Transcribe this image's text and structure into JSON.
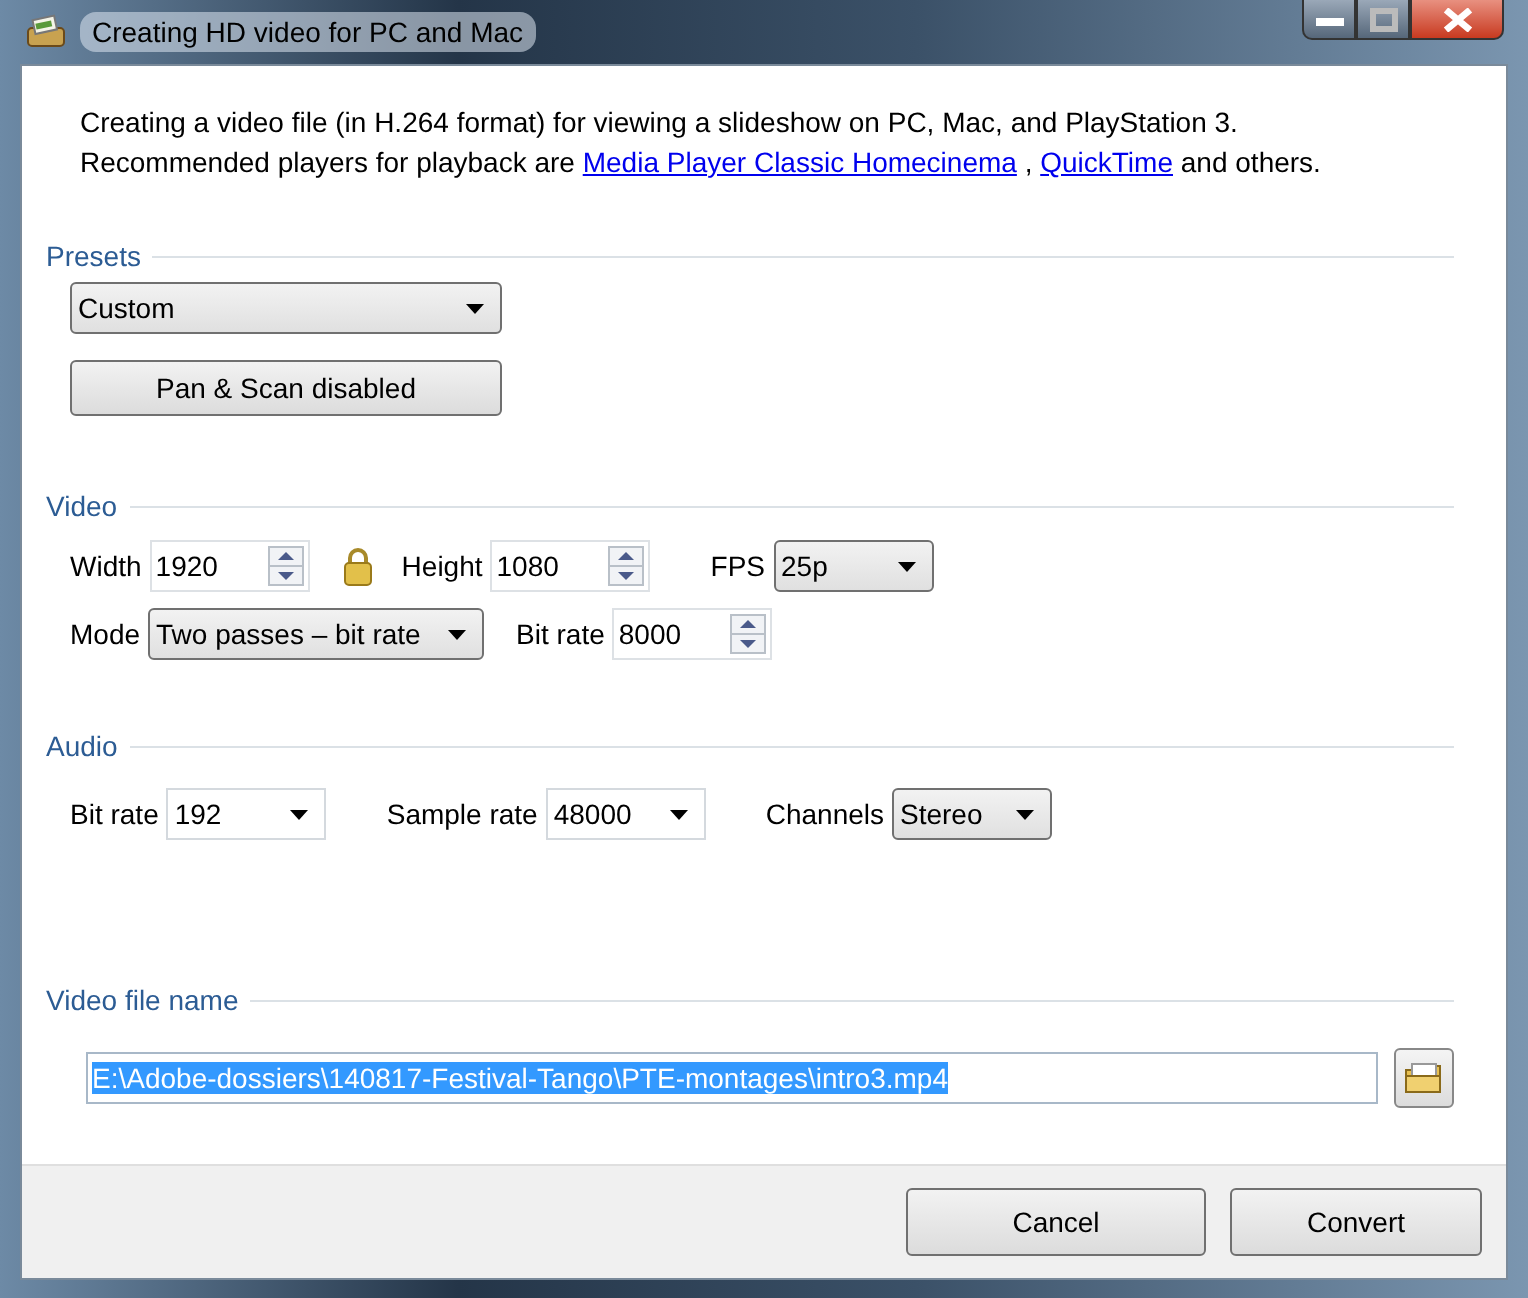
{
  "window": {
    "title": "Creating HD video for PC and Mac"
  },
  "intro": {
    "line1": "Creating a video file (in H.264 format) for viewing a slideshow on PC, Mac, and PlayStation 3.",
    "lead": "Recommended players for playback are",
    "links": [
      "Media Player Classic Homecinema",
      "QuickTime"
    ],
    "separator": ",",
    "tail": "and others."
  },
  "presets": {
    "title": "Presets",
    "dropdown": "Custom",
    "button": "Pan & Scan disabled"
  },
  "video": {
    "title": "Video",
    "rows": [
      [
        {
          "kind": "spin",
          "label": "Width",
          "value": "1920"
        },
        {
          "kind": "lock"
        },
        {
          "kind": "spin",
          "label": "Height",
          "value": "1080"
        },
        {
          "kind": "select",
          "label": "FPS",
          "value": "25p"
        }
      ],
      [
        {
          "kind": "select",
          "label": "Mode",
          "value": "Two passes – bit rate"
        },
        {
          "kind": "spin",
          "label": "Bit rate",
          "value": "8000"
        }
      ]
    ]
  },
  "audio": {
    "title": "Audio",
    "rows": [
      [
        {
          "kind": "combo",
          "label": "Bit rate",
          "value": "192"
        },
        {
          "kind": "combo",
          "label": "Sample rate",
          "value": "48000"
        },
        {
          "kind": "select",
          "label": "Channels",
          "value": "Stereo"
        }
      ]
    ]
  },
  "file": {
    "title": "Video file name",
    "value": "E:\\Adobe-dossiers\\140817-Festival-Tango\\PTE-montages\\intro3.mp4",
    "selected": true
  },
  "buttons": [
    "Cancel",
    "Convert"
  ]
}
